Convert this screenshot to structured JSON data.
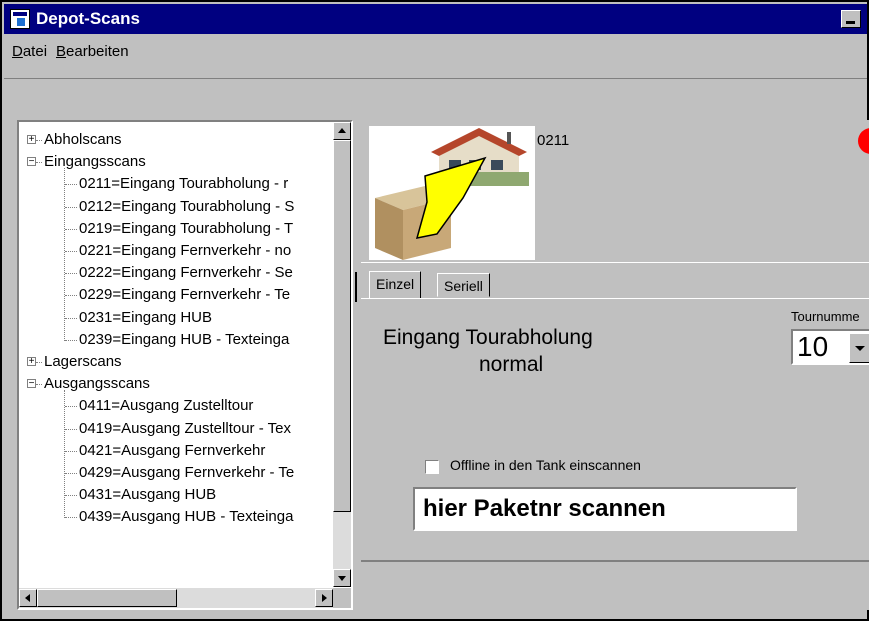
{
  "window": {
    "title": "Depot-Scans"
  },
  "menu": {
    "items": [
      {
        "key": "D",
        "rest": "atei"
      },
      {
        "key": "B",
        "rest": "earbeiten"
      }
    ]
  },
  "tree": {
    "groups": [
      {
        "label": "Abholscans",
        "expanded": false,
        "children": []
      },
      {
        "label": "Eingangsscans",
        "expanded": true,
        "children": [
          "0211=Eingang Tourabholung - r",
          "0212=Eingang Tourabholung - S",
          "0219=Eingang Tourabholung - T",
          "0221=Eingang Fernverkehr - no",
          "0222=Eingang Fernverkehr - Se",
          "0229=Eingang Fernverkehr - Te",
          "0231=Eingang HUB",
          "0239=Eingang HUB - Texteinga"
        ]
      },
      {
        "label": "Lagerscans",
        "expanded": false,
        "children": []
      },
      {
        "label": "Ausgangsscans",
        "expanded": true,
        "children": [
          "0411=Ausgang Zustelltour",
          "0419=Ausgang Zustelltour - Tex",
          "0421=Ausgang Fernverkehr",
          "0429=Ausgang Fernverkehr - Te",
          "0431=Ausgang HUB",
          "0439=Ausgang HUB - Texteinga"
        ]
      }
    ]
  },
  "detail": {
    "code": "0211",
    "tabs": [
      "Einzel",
      "Seriell"
    ],
    "active_tab": "Einzel",
    "scan_title": "Eingang Tourabholung",
    "scan_subtitle": "normal",
    "tour_label": "Tournumme",
    "tour_value": "10",
    "offline_label": "Offline in den Tank einscannen",
    "offline_checked": false,
    "scan_input_value": "hier Paketnr scannen"
  },
  "colors": {
    "title_bar": "#000080",
    "window_bg": "#c0c0c0",
    "status_dot": "#ff0000",
    "arrow_fill": "#ffff00"
  },
  "icons": [
    "app-icon",
    "minimize-icon",
    "expand-plus-icon",
    "collapse-minus-icon",
    "scroll-up-icon",
    "scroll-down-icon",
    "scroll-left-icon",
    "scroll-right-icon",
    "dropdown-arrow-icon",
    "status-dot-icon"
  ]
}
